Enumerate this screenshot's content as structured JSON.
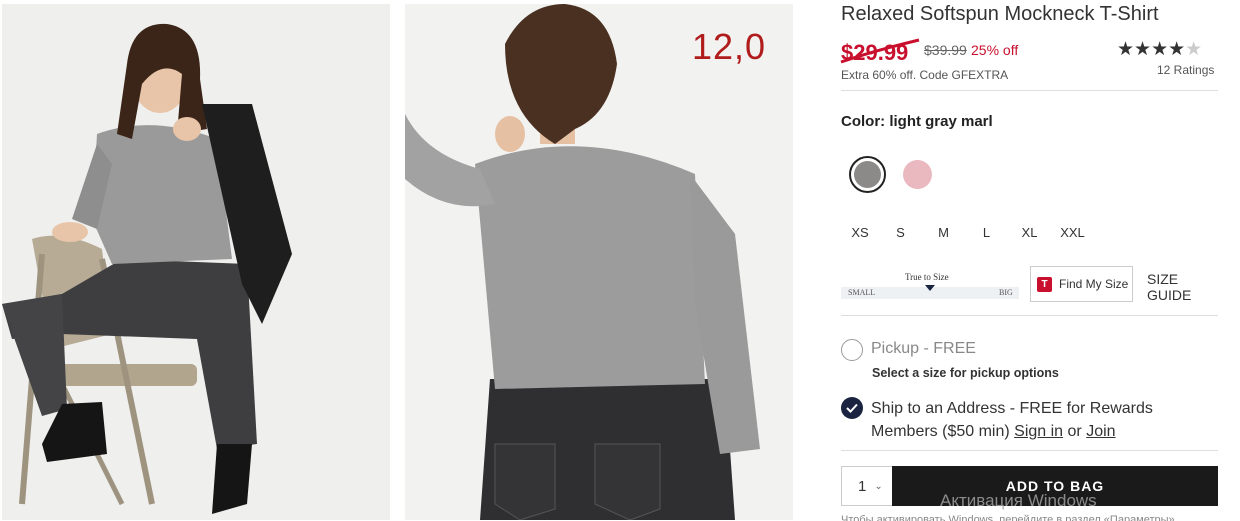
{
  "product": {
    "title": "Relaxed Softspun Mockneck T-Shirt",
    "sale_price": "$29.99",
    "original_price": "$39.99",
    "discount": "25% off",
    "promo": "Extra 60% off. Code GFEXTRA",
    "rating_stars": "★★★★",
    "rating_dim_star": "★",
    "rating_value": 4,
    "ratings_count": "12 Ratings"
  },
  "overlay_price_note": "12,0",
  "color": {
    "label": "Color: light gray marl",
    "swatches": [
      {
        "name": "light gray marl",
        "hex": "#8c8989",
        "selected": true
      },
      {
        "name": "pink",
        "hex": "#eab8bf",
        "selected": false
      }
    ]
  },
  "sizes": [
    "XS",
    "S",
    "M",
    "L",
    "XL",
    "XXL"
  ],
  "fit": {
    "label": "True to Size",
    "small": "SMALL",
    "big": "BIG"
  },
  "find_my_size": {
    "icon": "T",
    "label": "Find My Size"
  },
  "size_guide": "SIZE GUIDE",
  "fulfillment": {
    "pickup_label": "Pickup - FREE",
    "pickup_note": "Select a size for pickup options",
    "ship_text": "Ship to an Address - FREE for Rewards Members ($50 min)",
    "sign_in": "Sign in",
    "or": "or",
    "join": "Join"
  },
  "cart": {
    "quantity": "1",
    "add_to_bag": "ADD TO BAG"
  },
  "watermark": "Активация Windows",
  "bottom_text": "Чтобы активировать Windows, перейдите в раздел «Параметры»."
}
